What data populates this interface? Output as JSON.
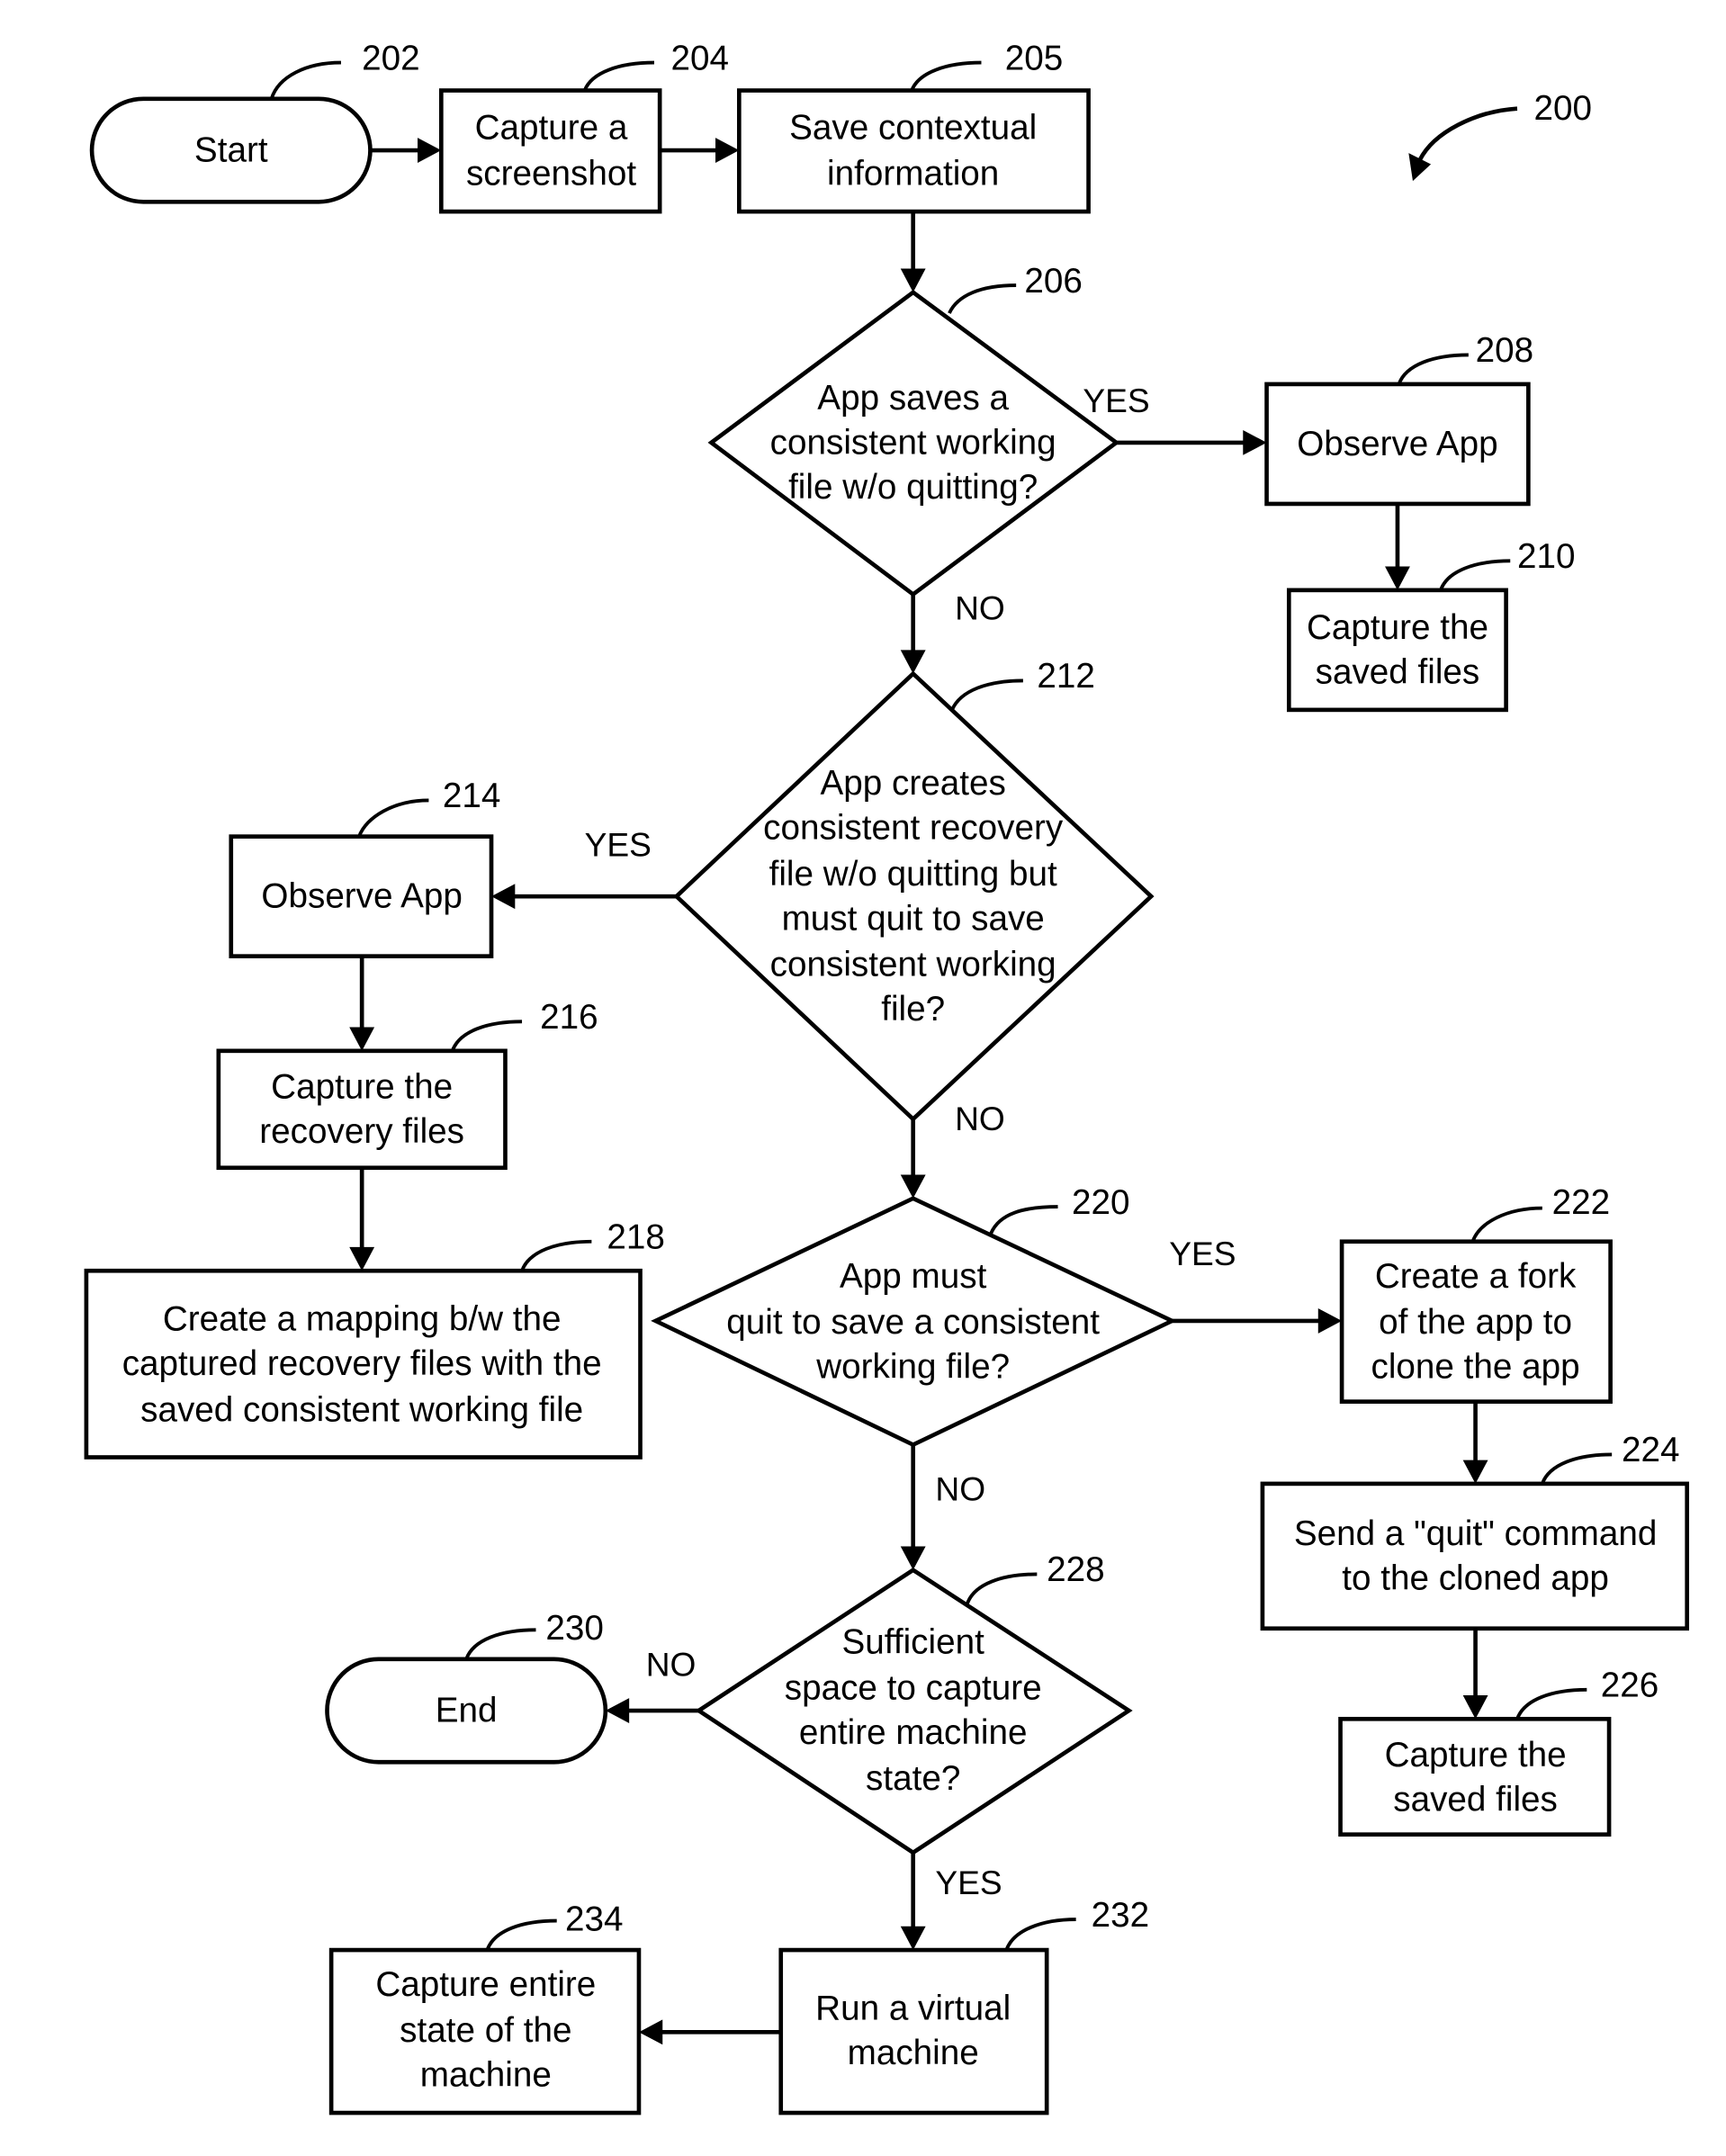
{
  "figure": {
    "ref": "200",
    "nodes": {
      "n202": {
        "ref": "202",
        "type": "terminal",
        "lines": [
          "Start"
        ]
      },
      "n204": {
        "ref": "204",
        "type": "process",
        "lines": [
          "Capture a",
          "screenshot"
        ]
      },
      "n205": {
        "ref": "205",
        "type": "process",
        "lines": [
          "Save contextual",
          "information"
        ]
      },
      "n206": {
        "ref": "206",
        "type": "decision",
        "lines": [
          "App saves a",
          "consistent working",
          "file w/o quitting?"
        ]
      },
      "n208": {
        "ref": "208",
        "type": "process",
        "lines": [
          "Observe App"
        ]
      },
      "n210": {
        "ref": "210",
        "type": "process",
        "lines": [
          "Capture the",
          "saved files"
        ]
      },
      "n212": {
        "ref": "212",
        "type": "decision",
        "lines": [
          "App creates",
          "consistent recovery",
          "file w/o quitting but",
          "must quit to save",
          "consistent working",
          "file?"
        ]
      },
      "n214": {
        "ref": "214",
        "type": "process",
        "lines": [
          "Observe App"
        ]
      },
      "n216": {
        "ref": "216",
        "type": "process",
        "lines": [
          "Capture the",
          "recovery files"
        ]
      },
      "n218": {
        "ref": "218",
        "type": "process",
        "lines": [
          "Create a mapping b/w the",
          "captured recovery files with the",
          "saved consistent working file"
        ]
      },
      "n220": {
        "ref": "220",
        "type": "decision",
        "lines": [
          "App must",
          "quit to save a consistent",
          "working file?"
        ]
      },
      "n222": {
        "ref": "222",
        "type": "process",
        "lines": [
          "Create a fork",
          "of the app to",
          "clone the app"
        ]
      },
      "n224": {
        "ref": "224",
        "type": "process",
        "lines": [
          "Send a \"quit\" command",
          "to the cloned app"
        ]
      },
      "n226": {
        "ref": "226",
        "type": "process",
        "lines": [
          "Capture the",
          "saved files"
        ]
      },
      "n228": {
        "ref": "228",
        "type": "decision",
        "lines": [
          "Sufficient",
          "space to capture",
          "entire machine",
          "state?"
        ]
      },
      "n230": {
        "ref": "230",
        "type": "terminal",
        "lines": [
          "End"
        ]
      },
      "n232": {
        "ref": "232",
        "type": "process",
        "lines": [
          "Run a virtual",
          "machine"
        ]
      },
      "n234": {
        "ref": "234",
        "type": "process",
        "lines": [
          "Capture entire",
          "state of the",
          "machine"
        ]
      }
    },
    "edges": [
      {
        "from": "202",
        "to": "204",
        "label": ""
      },
      {
        "from": "204",
        "to": "205",
        "label": ""
      },
      {
        "from": "205",
        "to": "206",
        "label": ""
      },
      {
        "from": "206",
        "to": "208",
        "label": "YES"
      },
      {
        "from": "206",
        "to": "212",
        "label": "NO"
      },
      {
        "from": "208",
        "to": "210",
        "label": ""
      },
      {
        "from": "212",
        "to": "214",
        "label": "YES"
      },
      {
        "from": "212",
        "to": "220",
        "label": "NO"
      },
      {
        "from": "214",
        "to": "216",
        "label": ""
      },
      {
        "from": "216",
        "to": "218",
        "label": ""
      },
      {
        "from": "220",
        "to": "222",
        "label": "YES"
      },
      {
        "from": "220",
        "to": "228",
        "label": "NO"
      },
      {
        "from": "222",
        "to": "224",
        "label": ""
      },
      {
        "from": "224",
        "to": "226",
        "label": ""
      },
      {
        "from": "228",
        "to": "230",
        "label": "NO"
      },
      {
        "from": "228",
        "to": "232",
        "label": "YES"
      },
      {
        "from": "232",
        "to": "234",
        "label": ""
      }
    ]
  }
}
